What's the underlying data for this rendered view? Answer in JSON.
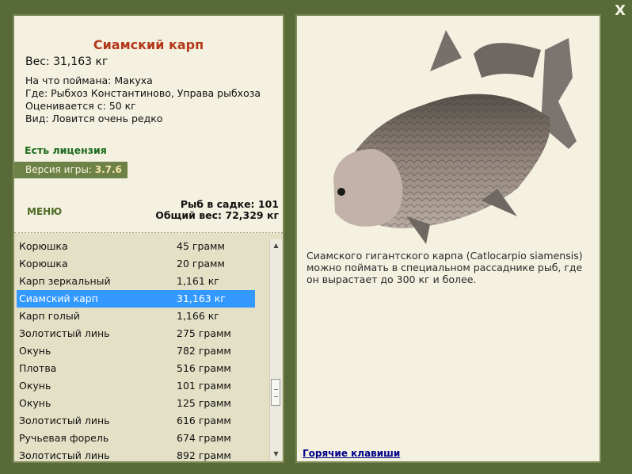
{
  "close_label": "X",
  "fish": {
    "title": "Сиамский карп",
    "weight": "Вес: 31,163 кг",
    "caught_on": "На что поймана: Макуха",
    "location": "Где: Рыбхоз Константиново, Управа рыбхоза",
    "valued": "Оценивается с: 50 кг",
    "rarity": "Вид: Ловится очень редко"
  },
  "license": "Есть лицензия",
  "version": {
    "label": "Версия игры:",
    "value": "3.7.6"
  },
  "menu_label": "МЕНЮ",
  "stats": {
    "fish_in_net": "Рыб в садке: 101",
    "total_weight": "Общий вес: 72,329 кг"
  },
  "catch_list": [
    {
      "name": "Корюшка",
      "weight": "45 грамм"
    },
    {
      "name": "Корюшка",
      "weight": "20 грамм"
    },
    {
      "name": "Карп зеркальный",
      "weight": "1,161 кг"
    },
    {
      "name": "Сиамский карп",
      "weight": "31,163 кг",
      "selected": true
    },
    {
      "name": "Карп голый",
      "weight": "1,166 кг"
    },
    {
      "name": "Золотистый линь",
      "weight": "275 грамм"
    },
    {
      "name": "Окунь",
      "weight": "782 грамм"
    },
    {
      "name": "Плотва",
      "weight": "516 грамм"
    },
    {
      "name": "Окунь",
      "weight": "101 грамм"
    },
    {
      "name": "Окунь",
      "weight": "125 грамм"
    },
    {
      "name": "Золотистый линь",
      "weight": "616 грамм"
    },
    {
      "name": "Ручьевая форель",
      "weight": "674 грамм"
    },
    {
      "name": "Золотистый линь",
      "weight": "892 грамм"
    }
  ],
  "description": "Сиамского гигантского карпа (Catlocarpio siamensis) можно поймать в специальном рассаднике рыб, где он вырастает до 300 кг и более.",
  "hotkeys_label": "Горячие клавиши"
}
